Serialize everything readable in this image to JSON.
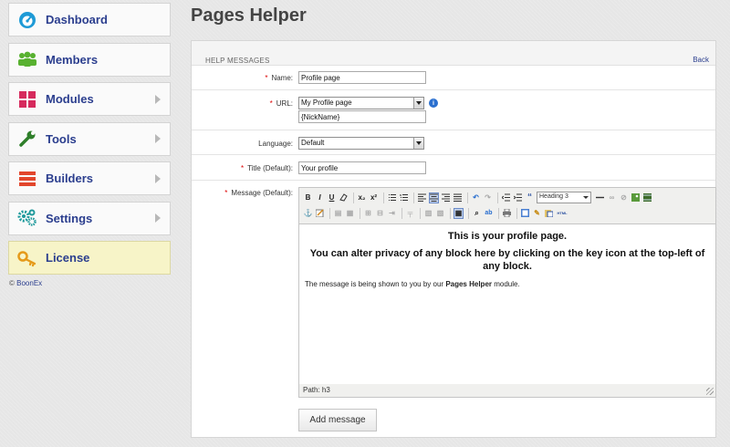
{
  "sidebar": {
    "items": [
      {
        "label": "Dashboard",
        "icon": "dashboard-gauge-icon",
        "color": "#1e9ad6",
        "arrow": false
      },
      {
        "label": "Members",
        "icon": "members-icon",
        "color": "#58b130",
        "arrow": false
      },
      {
        "label": "Modules",
        "icon": "modules-grid-icon",
        "color": "#d62a5d",
        "arrow": true
      },
      {
        "label": "Tools",
        "icon": "wrench-icon",
        "color": "#2f7f2a",
        "arrow": true
      },
      {
        "label": "Builders",
        "icon": "builders-bars-icon",
        "color": "#e2462c",
        "arrow": true
      },
      {
        "label": "Settings",
        "icon": "gears-icon",
        "color": "#1f9a9c",
        "arrow": true
      },
      {
        "label": "License",
        "icon": "key-icon",
        "color": "#e59a1a",
        "arrow": false
      }
    ],
    "copyright_symbol": "©",
    "copyright_link": "BoonEx"
  },
  "page": {
    "title": "Pages Helper"
  },
  "panel": {
    "header": "HELP MESSAGES",
    "back_link": "Back"
  },
  "form": {
    "name": {
      "label": "Name:",
      "value": "Profile page"
    },
    "url": {
      "label": "URL:",
      "selected": "My Profile page",
      "sub_value": "{NickName}"
    },
    "language": {
      "label": "Language:",
      "selected": "Default"
    },
    "title": {
      "label": "Title (Default):",
      "value": "Your profile"
    },
    "message": {
      "label": "Message (Default):"
    },
    "required_mark": "*",
    "submit_label": "Add message"
  },
  "editor": {
    "block_format": "Heading 3",
    "heading_line1": "This is your profile page.",
    "heading_line2": "You can alter privacy of any block here by clicking on the key icon at the top-left of any block.",
    "body_prefix": "The message is being shown to you by our ",
    "body_bold": "Pages Helper",
    "body_suffix": " module.",
    "status_path": "Path: h3",
    "toolbar_icons": {
      "bold": "B",
      "italic": "I",
      "underline": "U",
      "strike": "S",
      "subscript": "x₂",
      "superscript": "x²",
      "quote": "“",
      "html": "HTML"
    }
  },
  "colors": {
    "nav_text": "#2b3e8e",
    "required": "#dd0000",
    "license_bg": "#f7f4c8"
  }
}
